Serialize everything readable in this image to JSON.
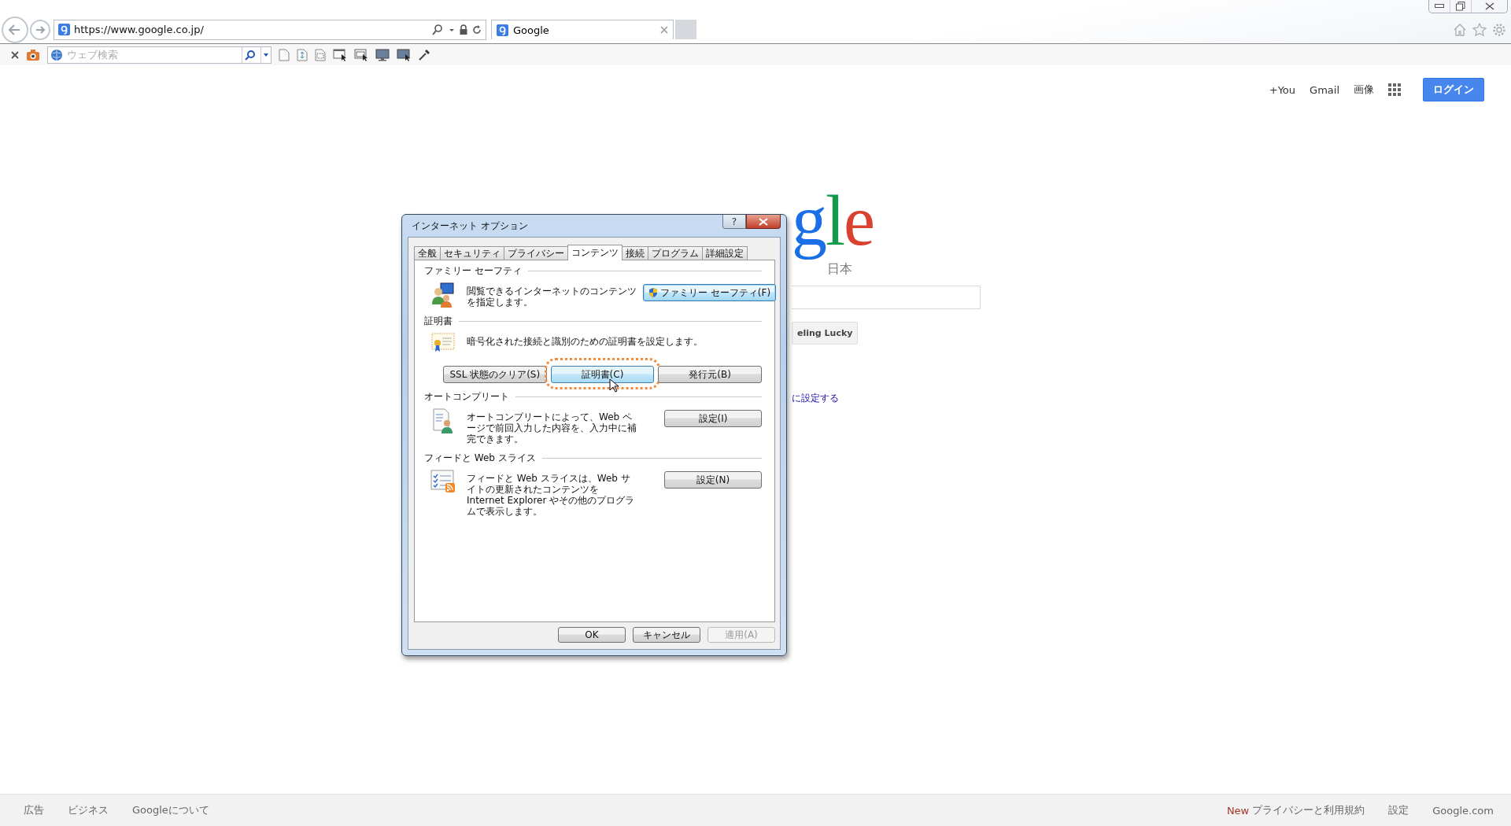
{
  "browser": {
    "address": "https://www.google.co.jp/",
    "tab": {
      "title": "Google"
    },
    "search": {
      "placeholder": "ウェブ検索"
    }
  },
  "page": {
    "header_links": [
      "+You",
      "Gmail",
      "画像"
    ],
    "login_button": "ログイン",
    "logo_text": "gle",
    "logo_region": "日本",
    "lucky_button": "eling Lucky",
    "link": "に設定する"
  },
  "dialog": {
    "title": "インターネット オプション",
    "help": "?",
    "tabs": [
      {
        "label": "全般",
        "selected": false
      },
      {
        "label": "セキュリティ",
        "selected": false
      },
      {
        "label": "プライバシー",
        "selected": false
      },
      {
        "label": "コンテンツ",
        "selected": true
      },
      {
        "label": "接続",
        "selected": false
      },
      {
        "label": "プログラム",
        "selected": false
      },
      {
        "label": "詳細設定",
        "selected": false
      }
    ],
    "sections": [
      {
        "kind": "family",
        "title": "ファミリー セーフティ",
        "description": "閲覧できるインターネットのコンテンツを指定します。",
        "buttons": [
          {
            "label": "ファミリー セーフティ(F)",
            "highlighted": true,
            "hovered": false,
            "circled": false
          }
        ]
      },
      {
        "kind": "certificates",
        "title": "証明書",
        "description": "暗号化された接続と識別のための証明書を設定します。",
        "buttons": [
          {
            "label": "SSL 状態のクリア(S)",
            "highlighted": false,
            "hovered": false,
            "circled": false
          },
          {
            "label": "証明書(C)",
            "highlighted": false,
            "hovered": true,
            "circled": true
          },
          {
            "label": "発行元(B)",
            "highlighted": false,
            "hovered": false,
            "circled": false
          }
        ]
      },
      {
        "kind": "autocomplete",
        "title": "オートコンプリート",
        "description": "オートコンプリートによって、Web ページで前回入力した内容を、入力中に補完できます。",
        "buttons": [
          {
            "label": "設定(I)",
            "highlighted": false,
            "hovered": false,
            "circled": false
          }
        ]
      },
      {
        "kind": "feeds",
        "title": "フィードと Web スライス",
        "description": "フィードと Web スライスは、Web サイトの更新されたコンテンツを Internet Explorer やその他のプログラムで表示します。",
        "buttons": [
          {
            "label": "設定(N)",
            "highlighted": false,
            "hovered": false,
            "circled": false
          }
        ]
      }
    ],
    "footer_buttons": [
      {
        "label": "OK",
        "disabled": false
      },
      {
        "label": "キャンセル",
        "disabled": false
      },
      {
        "label": "適用(A)",
        "disabled": true
      }
    ]
  },
  "footer": {
    "left": [
      "広告",
      "ビジネス",
      "Googleについて"
    ],
    "new_badge": "New",
    "right": [
      "プライバシーと利用規約",
      "設定",
      "Google.com"
    ]
  }
}
